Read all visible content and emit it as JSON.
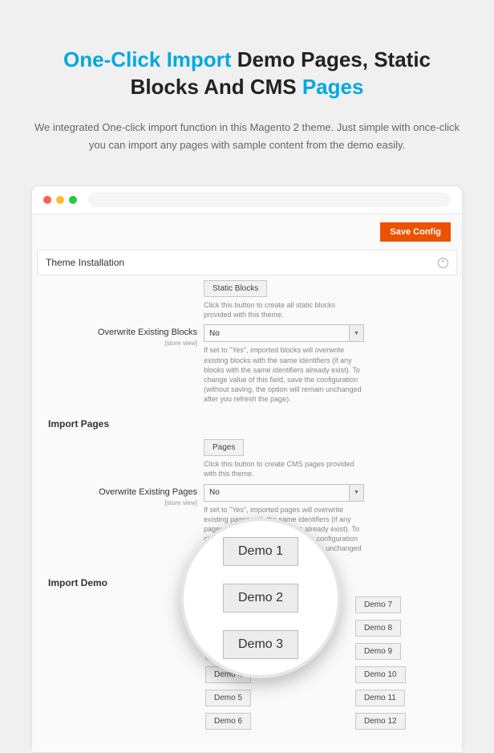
{
  "hero": {
    "title_accent1": "One-Click Import",
    "title_mid": " Demo Pages, Static Blocks And CMS ",
    "title_accent2": "Pages",
    "subtitle": "We integrated One-click import function in this Magento 2 theme. Just simple with once-click you can import any pages with sample content from the demo easily."
  },
  "actions": {
    "save": "Save Config"
  },
  "sections": {
    "theme_install": "Theme Installation",
    "import_pages": "Import Pages",
    "import_demo": "Import Demo"
  },
  "static_blocks": {
    "button": "Static Blocks",
    "help": "Click this button to create all static blocks provided with this theme."
  },
  "overwrite_blocks": {
    "label": "Overwrite Existing Blocks",
    "scope": "[store view]",
    "value": "No",
    "help": "If set to \"Yes\", imported blocks will overwrite existing blocks with the same identifiers (if any blocks with the same identifiers already exist). To change value of this field, save the configuration (without saving, the option will remain unchanged after you refresh the page)."
  },
  "pages": {
    "button": "Pages",
    "help": "Click this button to create CMS pages provided with this theme."
  },
  "overwrite_pages": {
    "label": "Overwrite Existing Pages",
    "scope": "[store view]",
    "value": "No",
    "help": "If set to \"Yes\", imported pages will overwrite existing pages with the same identifiers (if any pages with the same identifiers already exist). To change value of this field, save the configuration (without saving, the option will remain unchanged after you refresh the page)."
  },
  "demos": {
    "left": [
      "Demo 1",
      "Demo 2",
      "Demo 3",
      "Demo 4",
      "Demo 5",
      "Demo 6"
    ],
    "right": [
      "Demo 7",
      "Demo 8",
      "Demo 9",
      "Demo 10",
      "Demo 11",
      "Demo 12"
    ]
  },
  "magnifier": [
    "Demo 1",
    "Demo 2",
    "Demo 3"
  ]
}
